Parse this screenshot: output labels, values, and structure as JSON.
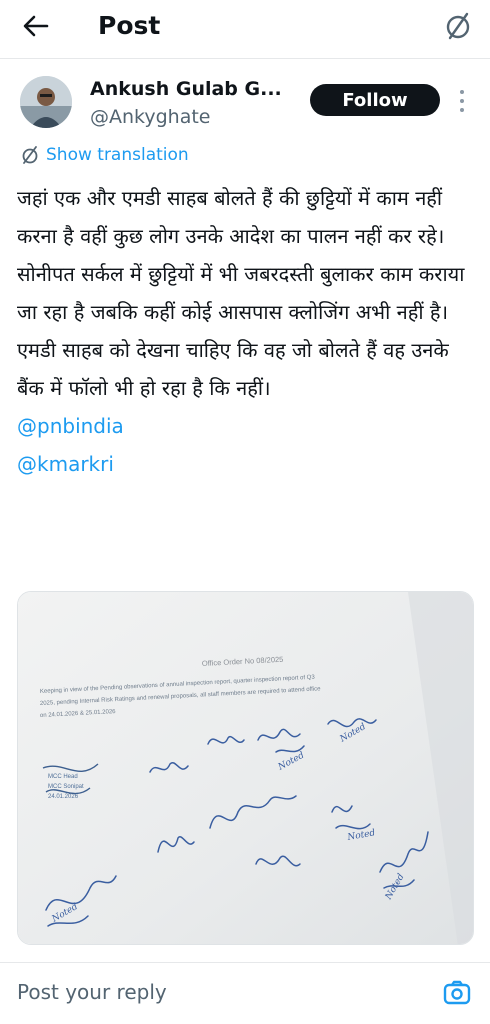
{
  "header": {
    "title": "Post",
    "back_icon": "arrow-left-icon",
    "translate_icon": "translate-off-icon"
  },
  "author": {
    "name": "Ankush Gulab G...",
    "handle": "@Ankyghate",
    "follow_label": "Follow"
  },
  "translation_label": "Show translation",
  "post": {
    "paragraphs": [
      "जहां एक और एमडी साहब बोलते हैं की छुट्टियों में काम नहीं करना है वहीं कुछ लोग उनके आदेश का पालन नहीं कर रहे।",
      "सोनीपत सर्कल में छुट्टियों में भी जबरदस्ती बुलाकर काम कराया जा रहा है जबकि कहीं कोई आसपास क्लोजिंग अभी नहीं है।",
      "एमडी साहब को देखना चाहिए कि वह जो बोलते हैं वह उनके बैंक में फॉलो भी हो रहा है कि नहीं।"
    ],
    "mentions": [
      "@pnbindia",
      "@kmarkri"
    ]
  },
  "document": {
    "heading": "Office Order No 08/2025",
    "lines": [
      "Keeping in view of the Pending observations of annual inspection report, quarter inspection report of Q3",
      "2025, pending Internal Risk Ratings and renewal proposals, all staff members are required to attend office",
      "on 24.01.2026 & 25.01.2026"
    ],
    "stamp": [
      "MCC Head",
      "MCC Sonipat",
      "24.01.2026"
    ],
    "notes": [
      "Noted",
      "Noted",
      "Noted",
      "Noted",
      "Noted"
    ]
  },
  "reply": {
    "placeholder": "Post your reply",
    "camera_icon": "camera-icon"
  },
  "colors": {
    "accent": "#1d9bf0",
    "text": "#0f1419",
    "muted": "#536471",
    "follow_bg": "#0f1419"
  }
}
